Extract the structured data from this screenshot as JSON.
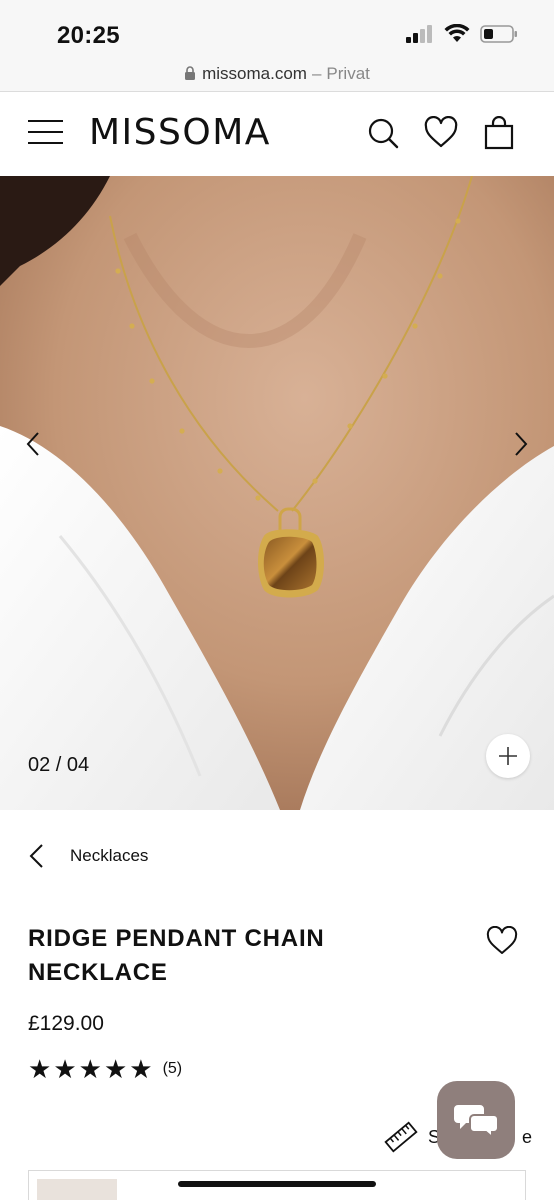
{
  "status_bar": {
    "time": "20:25"
  },
  "url_bar": {
    "domain": "missoma.com",
    "separator": "–",
    "mode": "Privat"
  },
  "header": {
    "brand": "MISSOMA"
  },
  "hero": {
    "counter": "02 / 04"
  },
  "product": {
    "breadcrumb": "Necklaces",
    "title_line1": "RIDGE PENDANT CHAIN",
    "title_line2": "NECKLACE",
    "price": "£129.00",
    "rating_stars": 5,
    "review_count": "(5)",
    "size_guide_visible": "S",
    "size_guide_tail": "e"
  },
  "colors": {
    "accent": "#111111",
    "chat": "#8f7f7c",
    "gold": "#c9a24a"
  }
}
